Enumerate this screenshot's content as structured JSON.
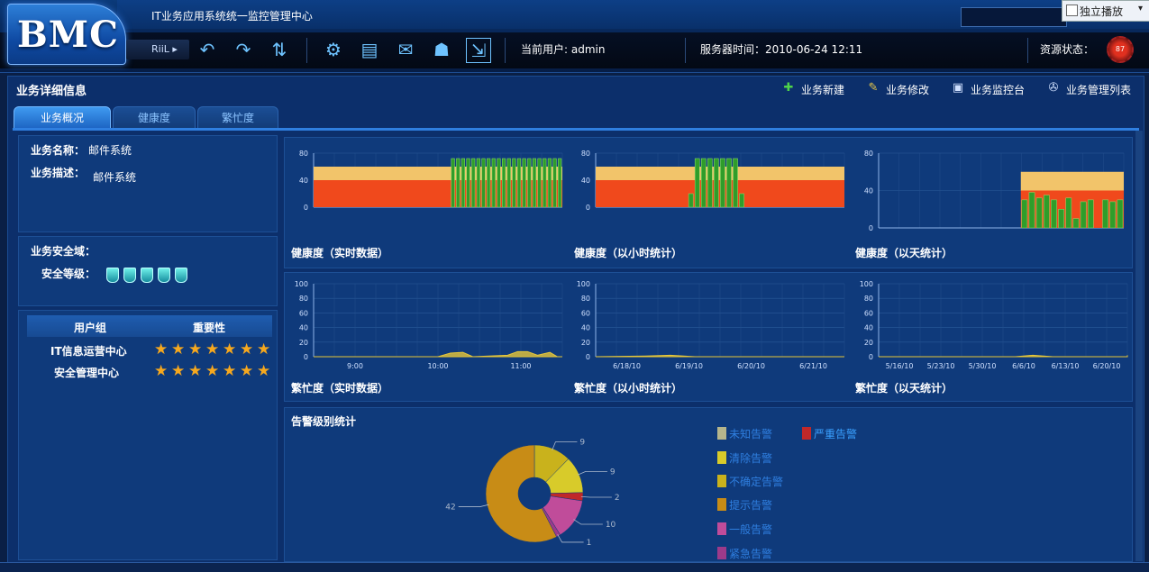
{
  "header": {
    "logo": "BMC",
    "system_title": "IT业务应用系统统一监控管理中心",
    "popout_label": "独立播放",
    "riil_label": "RiiL",
    "current_user": "当前用户: admin",
    "server_time": "服务器时间：2010-06-24 12:11",
    "resource_status": "资源状态：",
    "resource_status_value": "87"
  },
  "page": {
    "title": "业务详细信息",
    "actions": [
      "业务新建",
      "业务修改",
      "业务监控台",
      "业务管理列表"
    ],
    "tabs": [
      "业务概况",
      "健康度",
      "繁忙度"
    ]
  },
  "info": {
    "name_label": "业务名称：",
    "name_value": "邮件系统",
    "desc_label": "业务描述：",
    "desc_value": "邮件系统",
    "security_domain_label": "业务安全域：",
    "security_level_label": "安全等级：",
    "security_level": 5
  },
  "user_groups": {
    "headers": [
      "用户组",
      "重要性"
    ],
    "rows": [
      {
        "name": "IT信息运营中心",
        "stars": 7
      },
      {
        "name": "安全管理中心",
        "stars": 7
      }
    ]
  },
  "colors": {
    "health_bar_top": "#f2c46a",
    "health_bar": "#f0491c",
    "health_green": "#2f9d2a",
    "busy_line": "#e6c73a",
    "accent": "#2f7fe0"
  },
  "chart_data": [
    {
      "type": "bar",
      "title": "健康度（实时数据）",
      "ylim": [
        0,
        80
      ],
      "yticks": [
        0,
        40,
        80
      ],
      "bands": [
        40,
        60
      ]
    },
    {
      "type": "bar",
      "title": "健康度（以小时统计）",
      "ylim": [
        0,
        80
      ],
      "yticks": [
        0,
        40,
        80
      ],
      "bands": [
        40,
        60
      ]
    },
    {
      "type": "bar",
      "title": "健康度（以天统计）",
      "ylim": [
        0,
        80
      ],
      "yticks": [
        0,
        40,
        80
      ],
      "bands": [
        40,
        60
      ]
    },
    {
      "type": "area",
      "title": "繁忙度（实时数据）",
      "ylim": [
        0,
        100
      ],
      "yticks": [
        0,
        20,
        40,
        60,
        80,
        100
      ],
      "xticks": [
        "9:00",
        "10:00",
        "11:00"
      ]
    },
    {
      "type": "area",
      "title": "繁忙度（以小时统计）",
      "ylim": [
        0,
        100
      ],
      "yticks": [
        0,
        20,
        40,
        60,
        80,
        100
      ],
      "xticks": [
        "6/18/10",
        "6/19/10",
        "6/20/10",
        "6/21/10"
      ]
    },
    {
      "type": "area",
      "title": "繁忙度（以天统计）",
      "ylim": [
        0,
        100
      ],
      "yticks": [
        0,
        20,
        40,
        60,
        80,
        100
      ],
      "xticks": [
        "5/16/10",
        "5/23/10",
        "5/30/10",
        "6/6/10",
        "6/13/10",
        "6/20/10"
      ]
    },
    {
      "type": "pie",
      "title": "告警级别统计",
      "slices": [
        {
          "label": "不确定告警",
          "value": 9,
          "color": "#c9b21c"
        },
        {
          "label": "清除告警",
          "value": 9,
          "color": "#d8cb2a"
        },
        {
          "label": "严重告警",
          "value": 2,
          "color": "#c0282a"
        },
        {
          "label": "一般告警",
          "value": 10,
          "color": "#c04c9a"
        },
        {
          "label": "紧急告警",
          "value": 1,
          "color": "#9c3a8a"
        },
        {
          "label": "提示告警",
          "value": 42,
          "color": "#c88c16"
        }
      ],
      "legend": [
        {
          "label": "未知告警",
          "color": "#b5b58c"
        },
        {
          "label": "清除告警",
          "color": "#d8cb2a"
        },
        {
          "label": "不确定告警",
          "color": "#c9b21c"
        },
        {
          "label": "提示告警",
          "color": "#c88c16"
        },
        {
          "label": "一般告警",
          "color": "#c04c9a"
        },
        {
          "label": "紧急告警",
          "color": "#9c3a8a"
        },
        {
          "label": "严重告警",
          "color": "#c0282a"
        }
      ]
    }
  ]
}
